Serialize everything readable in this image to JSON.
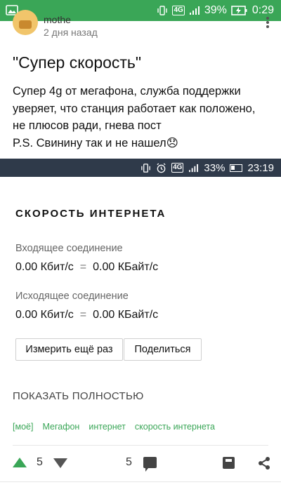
{
  "status_bar": {
    "battery": "39%",
    "time": "0:29",
    "network": "4G",
    "accent": "#3aa657"
  },
  "post": {
    "author": "mothe",
    "time_ago": "2 дня назад",
    "title": "\"Супер скорость\"",
    "body_lines": [
      "Супер 4g от мегафона, служба поддержки",
      "уверяет, что станция работает как положено,",
      "не плюсов ради, гнева пост",
      "P.S. Свинину так и не нашел😞"
    ]
  },
  "screenshot": {
    "status_bar": {
      "network": "4G",
      "battery": "33%",
      "time": "23:19"
    },
    "section_title": "СКОРОСТЬ ИНТЕРНЕТА",
    "incoming_label": "Входящее соединение",
    "incoming_value_kbit": "0.00 Кбит/с",
    "incoming_value_kbyte": "0.00 КБайт/с",
    "outgoing_label": "Исходящее соединение",
    "outgoing_value_kbit": "0.00 Кбит/с",
    "outgoing_value_kbyte": "0.00 КБайт/с",
    "equals": "=",
    "measure_again": "Измерить ещё раз",
    "share": "Поделиться"
  },
  "show_all": "ПОКАЗАТЬ ПОЛНОСТЬЮ",
  "tags": [
    "[моё]",
    "Мегафон",
    "интернет",
    "скорость интернета"
  ],
  "actions": {
    "score": "5",
    "comments": "5"
  }
}
